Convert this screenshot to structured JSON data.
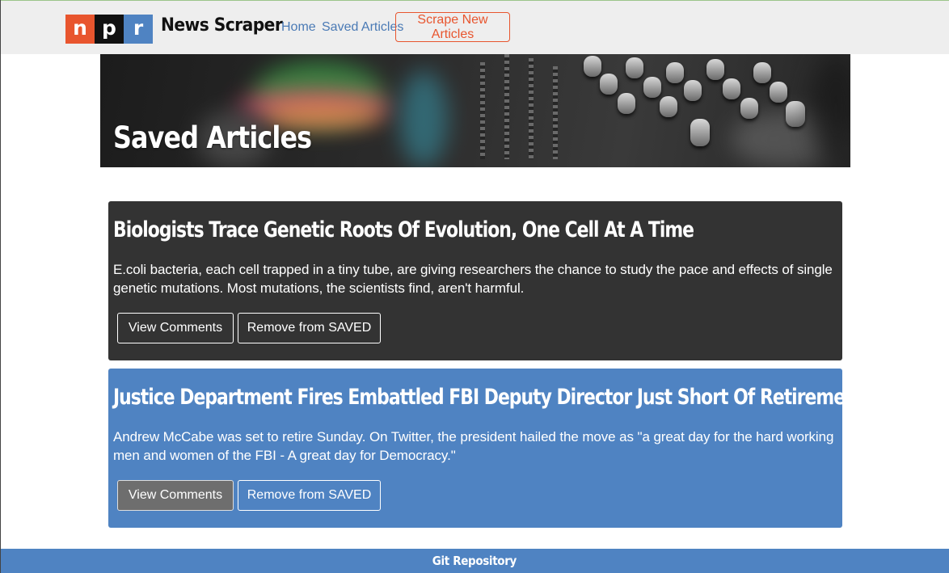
{
  "navbar": {
    "logo_letters": [
      "n",
      "p",
      "r"
    ],
    "logo_colors": [
      "#e8552e",
      "#111111",
      "#4f83c2"
    ],
    "brand": "News Scraper",
    "links": [
      {
        "label": "Home"
      },
      {
        "label": "Saved Articles"
      }
    ],
    "scrape_button": "Scrape New Articles",
    "accent_color": "#e8552e",
    "link_color": "#4a7ab5"
  },
  "hero": {
    "title": "Saved Articles"
  },
  "articles": [
    {
      "title": "Biologists Trace Genetic Roots Of Evolution, One Cell At A Time",
      "summary": "E.coli bacteria, each cell trapped in a tiny tube, are giving researchers the chance to study the pace and effects of single genetic mutations. Most mutations, the scientists find, aren't harmful.",
      "comments_button": "View Comments",
      "remove_button": "Remove from SAVED",
      "card_color": "#333333"
    },
    {
      "title": "Justice Department Fires Embattled FBI Deputy Director Just Short Of Retirement",
      "summary": "Andrew McCabe was set to retire Sunday. On Twitter, the president hailed the move as \"a great day for the hard working men and women of the FBI - A great day for Democracy.\"",
      "comments_button": "View Comments",
      "remove_button": "Remove from SAVED",
      "card_color": "#4f83c2"
    }
  ],
  "footer": {
    "link": "Git Repository",
    "color": "#4f83c2"
  }
}
